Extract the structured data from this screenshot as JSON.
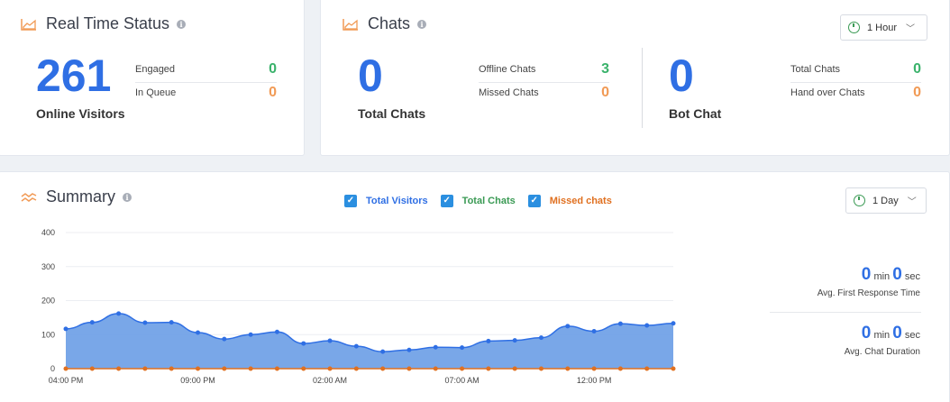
{
  "realtime": {
    "title": "Real Time Status",
    "online_visitors": "261",
    "online_label": "Online Visitors",
    "engaged_label": "Engaged",
    "engaged_value": "0",
    "queue_label": "In Queue",
    "queue_value": "0"
  },
  "chats": {
    "title": "Chats",
    "dropdown": "1 Hour",
    "total_chats": "0",
    "total_label": "Total Chats",
    "offline_label": "Offline Chats",
    "offline_value": "3",
    "missed_label": "Missed Chats",
    "missed_value": "0",
    "bot_chat": "0",
    "bot_label": "Bot Chat",
    "bot_total_label": "Total Chats",
    "bot_total_value": "0",
    "handover_label": "Hand over Chats",
    "handover_value": "0"
  },
  "summary": {
    "title": "Summary",
    "dropdown": "1 Day",
    "legend": [
      "Total Visitors",
      "Total Chats",
      "Missed chats"
    ],
    "first_response": {
      "min": "0",
      "min_unit": "min",
      "sec": "0",
      "sec_unit": "sec",
      "label": "Avg. First Response Time"
    },
    "chat_duration": {
      "min": "0",
      "min_unit": "min",
      "sec": "0",
      "sec_unit": "sec",
      "label": "Avg. Chat Duration"
    }
  },
  "colors": {
    "visitors": "#2f6fe4",
    "chats": "#3a9a54",
    "missed": "#e07020",
    "area": "#6a9de6"
  },
  "chart_data": {
    "type": "area",
    "ylim": [
      0,
      400
    ],
    "yticks": [
      "0",
      "100",
      "200",
      "300",
      "400"
    ],
    "xtick_labels": [
      "04:00 PM",
      "09:00 PM",
      "02:00 AM",
      "07:00 AM",
      "12:00 PM"
    ],
    "xtick_index": [
      0,
      5,
      10,
      15,
      20
    ],
    "series": [
      {
        "name": "Total Visitors",
        "values": [
          117,
          136,
          162,
          135,
          136,
          106,
          87,
          100,
          108,
          74,
          82,
          66,
          50,
          55,
          63,
          62,
          81,
          83,
          91,
          125,
          110,
          132,
          127,
          133
        ]
      },
      {
        "name": "Total Chats",
        "values": [
          0,
          0,
          0,
          0,
          0,
          0,
          0,
          0,
          0,
          0,
          0,
          0,
          0,
          0,
          0,
          0,
          0,
          0,
          0,
          0,
          0,
          0,
          0,
          0
        ]
      },
      {
        "name": "Missed chats",
        "values": [
          0,
          0,
          0,
          0,
          0,
          0,
          0,
          0,
          0,
          0,
          0,
          0,
          0,
          0,
          0,
          0,
          0,
          0,
          0,
          0,
          0,
          0,
          0,
          0
        ]
      }
    ]
  }
}
